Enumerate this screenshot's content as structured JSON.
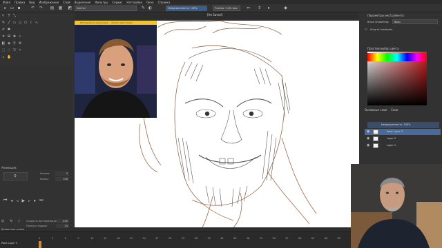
{
  "menubar": {
    "items": [
      "Файл",
      "Правка",
      "Вид",
      "Изображение",
      "Слой",
      "Выделение",
      "Фильтры",
      "Сервис",
      "Настройки",
      "Окно",
      "Справка"
    ]
  },
  "toolbar": {
    "blend_mode": "Normal",
    "opacity": "Непрозрачность: 100%",
    "size": "Размер: 5,00 пикс"
  },
  "document": {
    "tab_title": "[Не Saved]"
  },
  "left_panel": {
    "layers_label": "Анимация:",
    "current_frame": "0",
    "start_label": "Начало:",
    "start_value": "0",
    "end_label": "Конец:",
    "end_value": "100",
    "onion_label": "Скорость воспроизведения:",
    "onion_value": "1,00",
    "drop_label": "Пропуск кадров:",
    "fps_value": "24"
  },
  "streamer_banner": "Инструменты художника — запись трансляции",
  "right_dock": {
    "brush_panel_title": "Параметры инструмента",
    "brush_smoothing_label": "Brush Smoothing:",
    "brush_smoothing_value": "Basic",
    "snap_label": "Snap to Assistants",
    "color_panel_title": "Простой выбор цвета",
    "layer_tabs": [
      "Основные слои",
      "Слои"
    ],
    "layer_opacity": "Непрозрачность: 100%",
    "layers": [
      {
        "name": "Paint Layer 3",
        "active": true
      },
      {
        "name": "Layer 2",
        "active": false
      },
      {
        "name": "Layer 1",
        "active": false
      }
    ]
  },
  "timeline": {
    "title": "Временная шкала",
    "layer_name": "Paint Layer 3",
    "ticks": [
      "0",
      "3",
      "6",
      "9",
      "12",
      "15",
      "18",
      "21",
      "24",
      "27",
      "30",
      "33",
      "36",
      "39",
      "42",
      "45",
      "48",
      "51",
      "54",
      "57",
      "60",
      "63",
      "66",
      "69",
      "72",
      "75",
      "78",
      "81",
      "84",
      "87",
      "90"
    ]
  },
  "colors": {
    "accent": "#4a6a9a",
    "timeline_playhead": "#d28a3a",
    "sketch": "#8a5a3a"
  }
}
